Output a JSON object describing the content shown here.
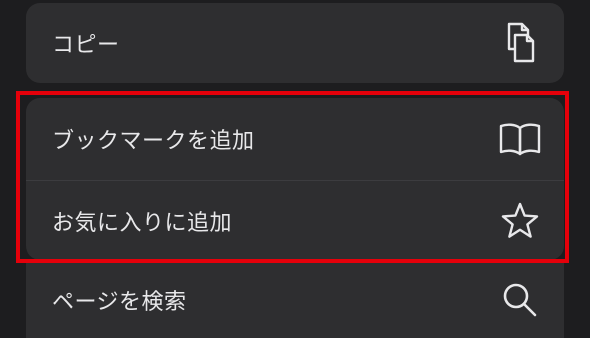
{
  "menu": {
    "copy_label": "コピー",
    "copy_icon": "copy-icon",
    "add_bookmark_label": "ブックマークを追加",
    "add_bookmark_icon": "book-icon",
    "add_favorite_label": "お気に入りに追加",
    "add_favorite_icon": "star-icon",
    "find_on_page_label": "ページを検索",
    "find_on_page_icon": "search-icon"
  },
  "colors": {
    "highlight": "#e5000a",
    "background": "#1d1d1f",
    "row_background": "#2e2e30",
    "text": "#e8e8ea",
    "icon": "#e8e8ea"
  }
}
